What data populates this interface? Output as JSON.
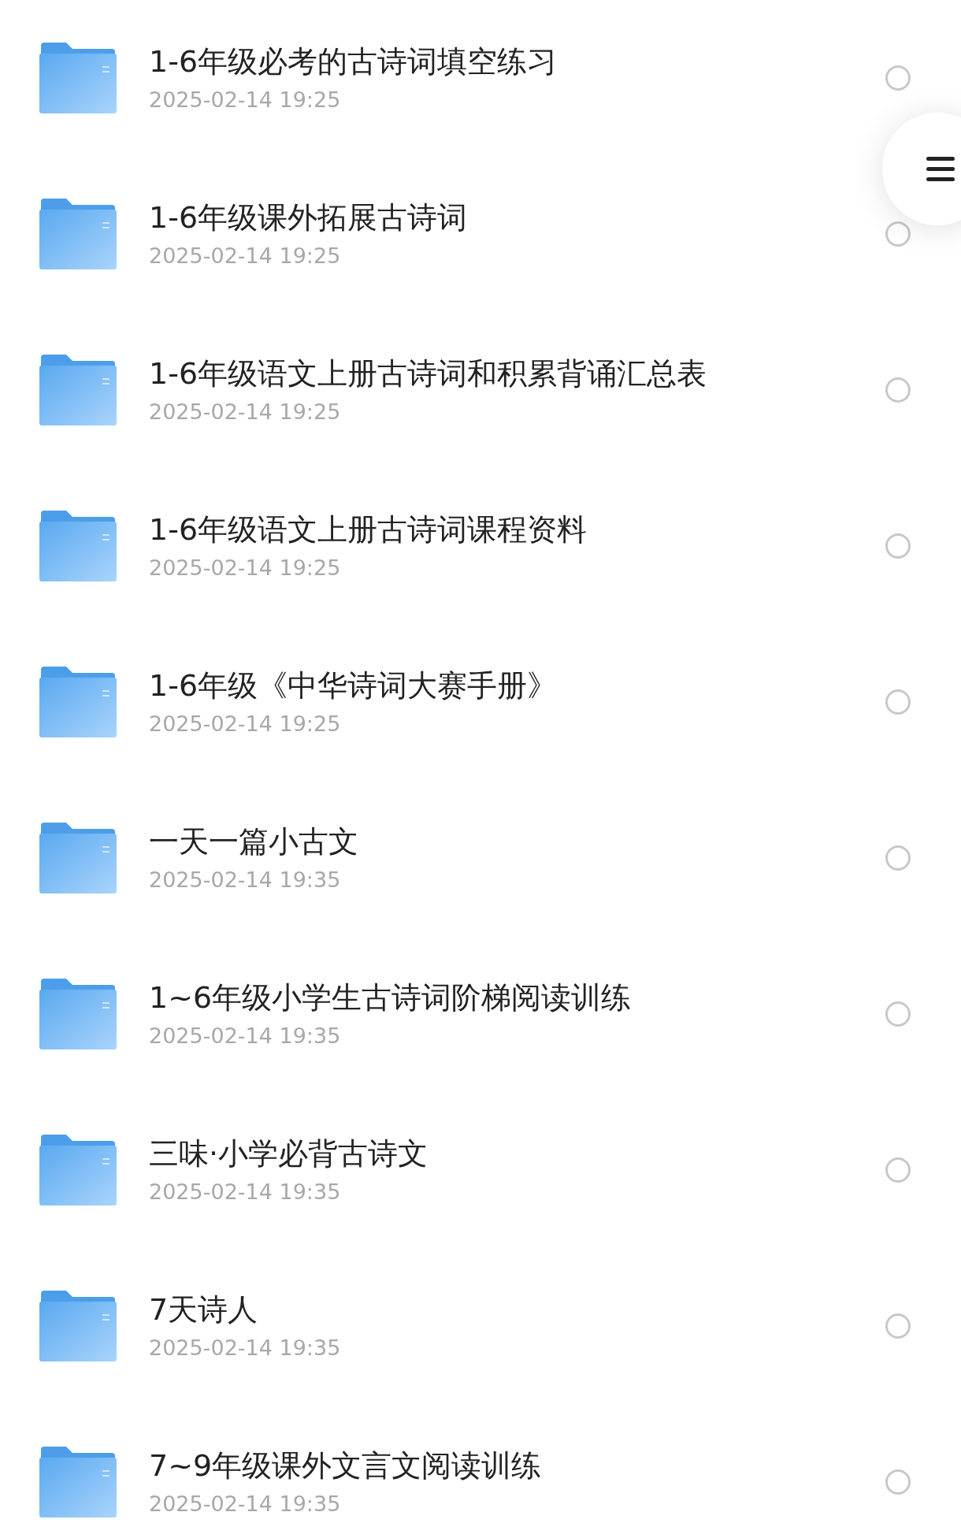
{
  "files": [
    {
      "name": "1-6年级必考的古诗词填空练习",
      "date": "2025-02-14 19:25",
      "selected": false
    },
    {
      "name": "1-6年级课外拓展古诗词",
      "date": "2025-02-14 19:25",
      "selected": false
    },
    {
      "name": "1-6年级语文上册古诗词和积累背诵汇总表",
      "date": "2025-02-14 19:25",
      "selected": false
    },
    {
      "name": "1-6年级语文上册古诗词课程资料",
      "date": "2025-02-14 19:25",
      "selected": false
    },
    {
      "name": "1-6年级《中华诗词大赛手册》",
      "date": "2025-02-14 19:25",
      "selected": false
    },
    {
      "name": "一天一篇小古文",
      "date": "2025-02-14 19:35",
      "selected": false
    },
    {
      "name": "1~6年级小学生古诗词阶梯阅读训练",
      "date": "2025-02-14 19:35",
      "selected": false
    },
    {
      "name": "三味·小学必背古诗文",
      "date": "2025-02-14 19:35",
      "selected": false
    },
    {
      "name": "7天诗人",
      "date": "2025-02-14 19:35",
      "selected": false
    },
    {
      "name": "7~9年级课外文言文阅读训练",
      "date": "2025-02-14 19:35",
      "selected": false
    }
  ]
}
